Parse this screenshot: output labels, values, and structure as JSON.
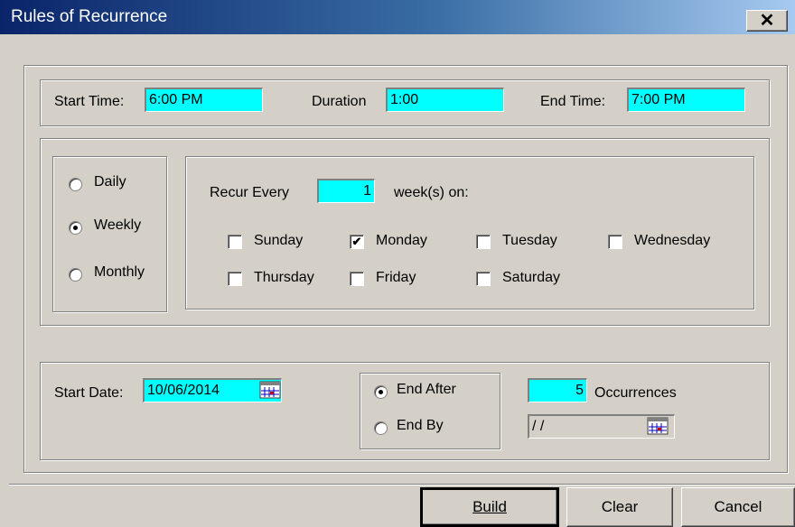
{
  "window": {
    "title": "Rules of Recurrence",
    "close_label": "✕"
  },
  "time": {
    "start_label": "Start Time:",
    "start_value": "6:00 PM",
    "duration_label": "Duration",
    "duration_value": "1:00",
    "end_label": "End Time:",
    "end_value": "7:00 PM"
  },
  "frequency": {
    "options": [
      "Daily",
      "Weekly",
      "Monthly"
    ],
    "selected": "Weekly"
  },
  "recur": {
    "label": "Recur Every",
    "value": "1",
    "suffix": "week(s) on:",
    "days": [
      {
        "label": "Sunday",
        "checked": false
      },
      {
        "label": "Monday",
        "checked": true
      },
      {
        "label": "Tuesday",
        "checked": false
      },
      {
        "label": "Wednesday",
        "checked": false
      },
      {
        "label": "Thursday",
        "checked": false
      },
      {
        "label": "Friday",
        "checked": false
      },
      {
        "label": "Saturday",
        "checked": false
      }
    ]
  },
  "range": {
    "start_date_label": "Start Date:",
    "start_date_value": "10/06/2014",
    "end_after_label": "End After",
    "end_by_label": "End By",
    "selected": "End After",
    "occurrences_value": "5",
    "occurrences_label": "Occurrences",
    "end_by_value": " / /"
  },
  "buttons": {
    "build": "Build",
    "clear": "Clear",
    "cancel": "Cancel"
  },
  "icons": {
    "calendar": "calendar-icon",
    "close": "close-icon",
    "check": "✔"
  }
}
